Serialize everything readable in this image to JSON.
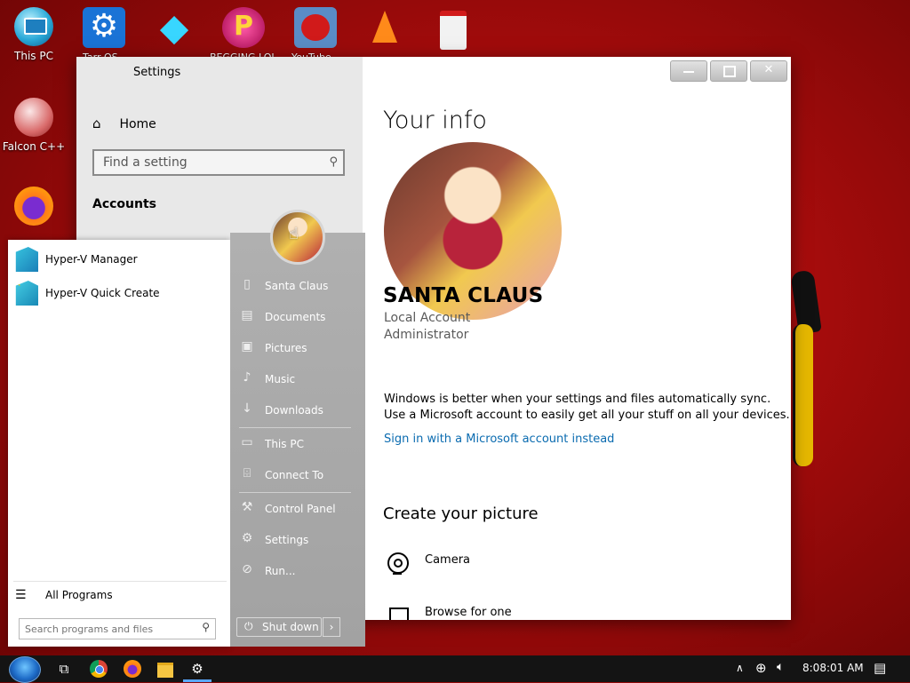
{
  "desktop": {
    "left_icons": [
      {
        "label": "This PC",
        "icon": "this-pc-icon"
      },
      {
        "label": "Falcon C++",
        "icon": "falcon-cpp-icon"
      },
      {
        "label": "",
        "icon": "firefox-icon"
      }
    ],
    "top_icons": [
      {
        "label": "Tarr OS",
        "icon": "settings-gear-icon"
      },
      {
        "label": "",
        "icon": "diamond-icon"
      },
      {
        "label": "BEGGING LOL",
        "icon": "p-game-icon"
      },
      {
        "label": "YouTube",
        "icon": "angry-bird-icon"
      },
      {
        "label": "",
        "icon": "vlc-cone-icon"
      },
      {
        "label": "",
        "icon": "document-icon"
      }
    ]
  },
  "settings": {
    "title": "Settings",
    "home_label": "Home",
    "search_placeholder": "Find a setting",
    "section_label": "Accounts",
    "heading": "Your info",
    "user_name": "SANTA CLAUS",
    "account_type": "Local Account",
    "account_role": "Administrator",
    "sync_line1": "Windows is better when your settings and files automatically sync.",
    "sync_line2": "Use a Microsoft account to easily get all your stuff on all your devices.",
    "sign_in_link": "Sign in with a Microsoft account instead",
    "create_heading": "Create your picture",
    "camera_label": "Camera",
    "browse_label": "Browse for one"
  },
  "start_menu": {
    "apps": [
      {
        "label": "Hyper-V Manager"
      },
      {
        "label": "Hyper-V Quick Create"
      }
    ],
    "all_programs": "All Programs",
    "search_placeholder": "Search programs and files",
    "right_items": [
      {
        "label": "Santa Claus",
        "icon": "user-icon"
      },
      {
        "label": "Documents",
        "icon": "documents-icon"
      },
      {
        "label": "Pictures",
        "icon": "pictures-icon"
      },
      {
        "label": "Music",
        "icon": "music-icon"
      },
      {
        "label": "Downloads",
        "icon": "downloads-icon"
      },
      {
        "label": "This PC",
        "icon": "computer-icon"
      },
      {
        "label": "Connect To",
        "icon": "connect-icon"
      },
      {
        "label": "Control Panel",
        "icon": "control-panel-icon"
      },
      {
        "label": "Settings",
        "icon": "gear-icon"
      },
      {
        "label": "Run...",
        "icon": "run-icon"
      }
    ],
    "shutdown_label": "Shut down"
  },
  "taskbar": {
    "clock": "8:08:01 AM"
  }
}
